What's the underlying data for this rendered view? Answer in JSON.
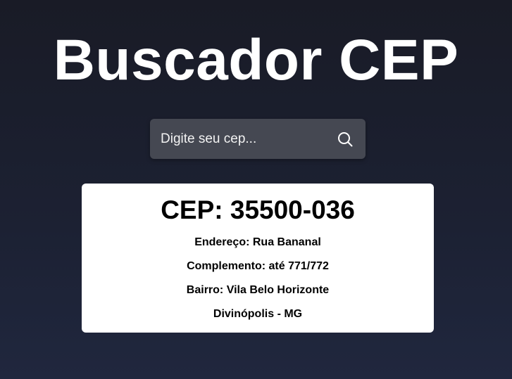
{
  "header": {
    "title": "Buscador CEP"
  },
  "search": {
    "placeholder": "Digite seu cep...",
    "value": "",
    "icon": "search-icon"
  },
  "result": {
    "cep_label": "CEP: 35500-036",
    "endereco": "Endereço: Rua Bananal",
    "complemento": "Complemento: até 771/772",
    "bairro": "Bairro: Vila Belo Horizonte",
    "cidade_uf": "Divinópolis - MG"
  },
  "colors": {
    "background_top": "#191b26",
    "background_bottom": "#20273e",
    "search_box": "#454852",
    "card": "#ffffff"
  }
}
